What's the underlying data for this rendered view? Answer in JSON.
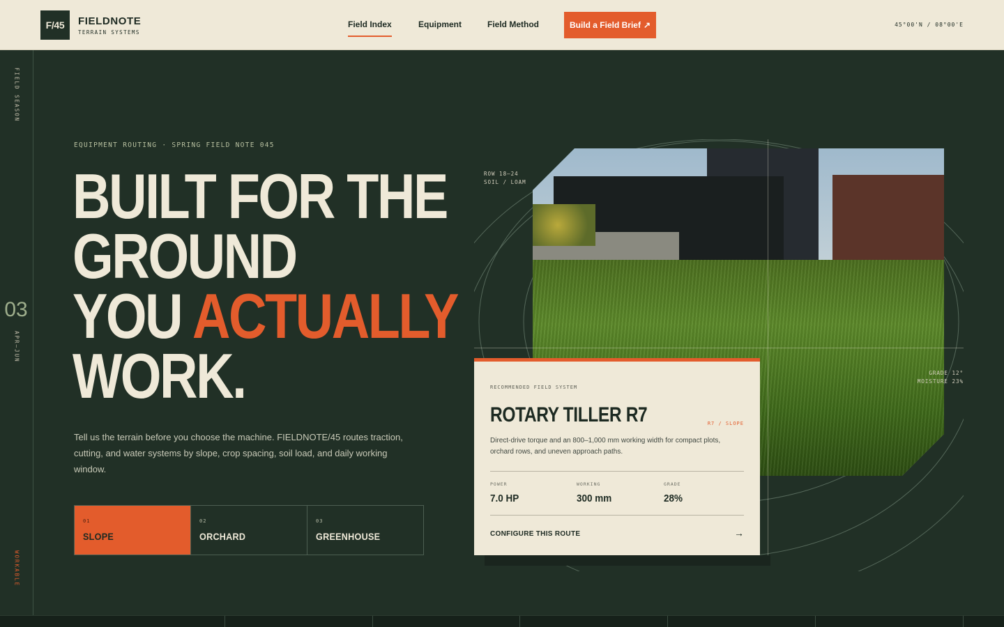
{
  "header": {
    "logo_mark": "F/45",
    "brand_name": "FIELDNOTE",
    "brand_tagline": "TERRAIN SYSTEMS",
    "nav": [
      "Field Index",
      "Equipment",
      "Field Method"
    ],
    "cta_label": "Build a Field Brief",
    "cta_icon": "↗",
    "coordinates": "45°00'N / 08°00'E"
  },
  "rail": {
    "top_label": "FIELD SEASON",
    "number": "03",
    "range": "APR–JUN",
    "bottom_label": "WORKABLE"
  },
  "hero": {
    "eyebrow": "EQUIPMENT ROUTING · SPRING FIELD NOTE 045",
    "headline_line1": "BUILT FOR THE",
    "headline_line2": "GROUND",
    "headline_line3_pre": "YOU ",
    "headline_line3_accent": "ACTUALLY",
    "headline_line4": "WORK.",
    "lede": "Tell us the terrain before you choose the machine. FIELDNOTE/45 routes traction, cutting, and water systems by slope, crop spacing, soil load, and daily working window.",
    "tabs": [
      {
        "num": "01",
        "label": "SLOPE"
      },
      {
        "num": "02",
        "label": "ORCHARD"
      },
      {
        "num": "03",
        "label": "GREENHOUSE"
      }
    ]
  },
  "visual": {
    "tag_top_line1": "ROW 18–24",
    "tag_top_line2": "SOIL / LOAM",
    "tag_right_line1": "GRADE 12°",
    "tag_right_line2": "MOISTURE 23%"
  },
  "card": {
    "eyebrow": "RECOMMENDED FIELD SYSTEM",
    "title": "ROTARY TILLER R7",
    "tag": "R7 / SLOPE",
    "description": "Direct-drive torque and an 800–1,000 mm working width for compact plots, orchard rows, and uneven approach paths.",
    "stats": [
      {
        "label": "POWER",
        "value": "7.0 HP"
      },
      {
        "label": "WORKING",
        "value": "300 mm"
      },
      {
        "label": "GRADE",
        "value": "28%"
      }
    ],
    "link_label": "CONFIGURE THIS ROUTE",
    "link_arrow": "→"
  },
  "colors": {
    "background": "#213026",
    "paper": "#efe9d8",
    "accent": "#e35c2c"
  }
}
